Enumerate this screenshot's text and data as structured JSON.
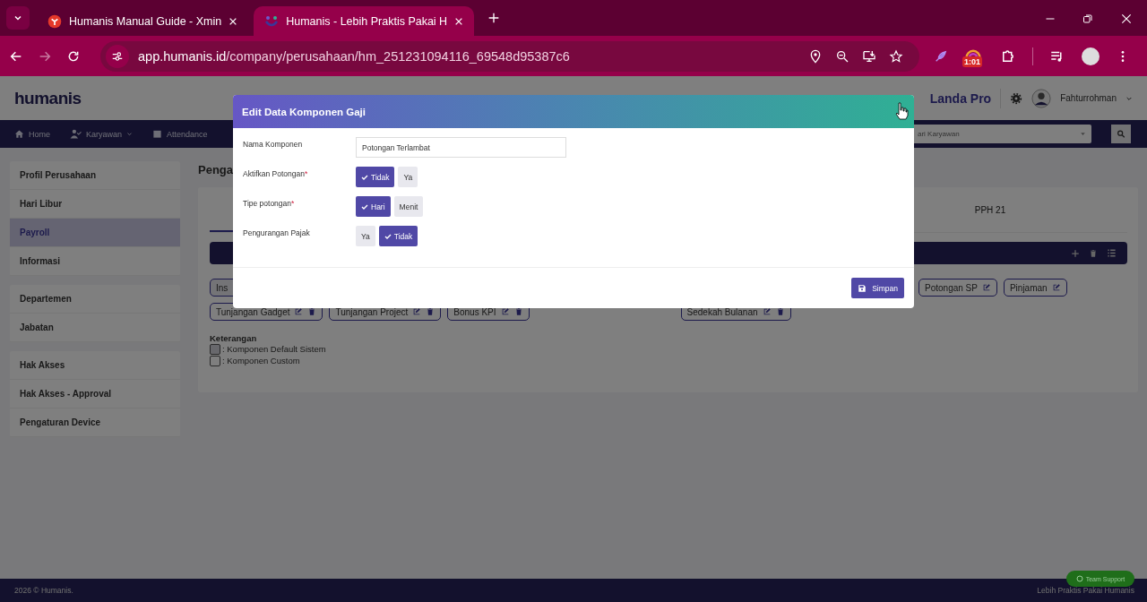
{
  "browser": {
    "tabs": [
      {
        "title": "Humanis Manual Guide - Xmin",
        "selected": false
      },
      {
        "title": "Humanis - Lebih Praktis Pakai H",
        "selected": true
      }
    ],
    "url_host": "app.humanis.id",
    "url_path": "/company/perusahaan/hm_251231094116_69548d95387c6",
    "extension_badge": "1:01"
  },
  "header": {
    "logo": "humanis",
    "plan": "Landa Pro",
    "user": "Fahturrohman"
  },
  "nav": {
    "items": [
      "Home",
      "Karyawan",
      "Attendance"
    ],
    "search_placeholder": "ari Karyawan"
  },
  "sidebar": {
    "groups": [
      [
        {
          "label": "Profil Perusahaan",
          "selected": false
        },
        {
          "label": "Hari Libur",
          "selected": false
        },
        {
          "label": "Payroll",
          "selected": true
        },
        {
          "label": "Informasi",
          "selected": false
        }
      ],
      [
        {
          "label": "Departemen",
          "selected": false
        },
        {
          "label": "Jabatan",
          "selected": false
        }
      ],
      [
        {
          "label": "Hak Akses",
          "selected": false
        },
        {
          "label": "Hak Akses - Approval",
          "selected": false
        },
        {
          "label": "Pengaturan Device",
          "selected": false
        }
      ]
    ]
  },
  "content": {
    "title": "Penga",
    "tab": "PPH 21",
    "chip_rows": [
      {
        "left": [
          {
            "label": "Ins"
          }
        ],
        "right": [
          {
            "label": "Potongan SP",
            "deletable": false
          },
          {
            "label": "Pinjaman",
            "deletable": false
          }
        ]
      },
      {
        "left": [
          {
            "label": "Tunjangan Gadget",
            "deletable": true
          },
          {
            "label": "Tunjangan Project",
            "deletable": true
          },
          {
            "label": "Bonus KPI",
            "deletable": true
          }
        ],
        "right": [
          {
            "label": "Sedekah Bulanan",
            "deletable": true
          }
        ]
      }
    ],
    "legend_title": "Keterangan",
    "legend": [
      {
        "label": ": Komponen Default Sistem",
        "kind": "default"
      },
      {
        "label": ": Komponen Custom",
        "kind": "custom"
      }
    ]
  },
  "modal": {
    "title": "Edit Data Komponen Gaji",
    "fields": [
      {
        "label": "Nama Komponen",
        "kind": "text",
        "value": "Potongan Terlambat"
      },
      {
        "label": "Aktifkan Potongan",
        "required_mark": "*",
        "kind": "toggle",
        "options": [
          {
            "label": "Tidak",
            "selected": true
          },
          {
            "label": "Ya",
            "selected": false
          }
        ]
      },
      {
        "label": "Tipe potongan",
        "required_mark": "*",
        "kind": "toggle",
        "options": [
          {
            "label": "Hari",
            "selected": true
          },
          {
            "label": "Menit",
            "selected": false
          }
        ]
      },
      {
        "label": "Pengurangan Pajak",
        "kind": "toggle",
        "options": [
          {
            "label": "Ya",
            "selected": false
          },
          {
            "label": "Tidak",
            "selected": true
          }
        ]
      }
    ],
    "save": "Simpan"
  },
  "footer": {
    "copyright": "2026 © Humanis.",
    "tagline": "Lebih Praktis Pakai Humanis",
    "support": "Team Support"
  }
}
